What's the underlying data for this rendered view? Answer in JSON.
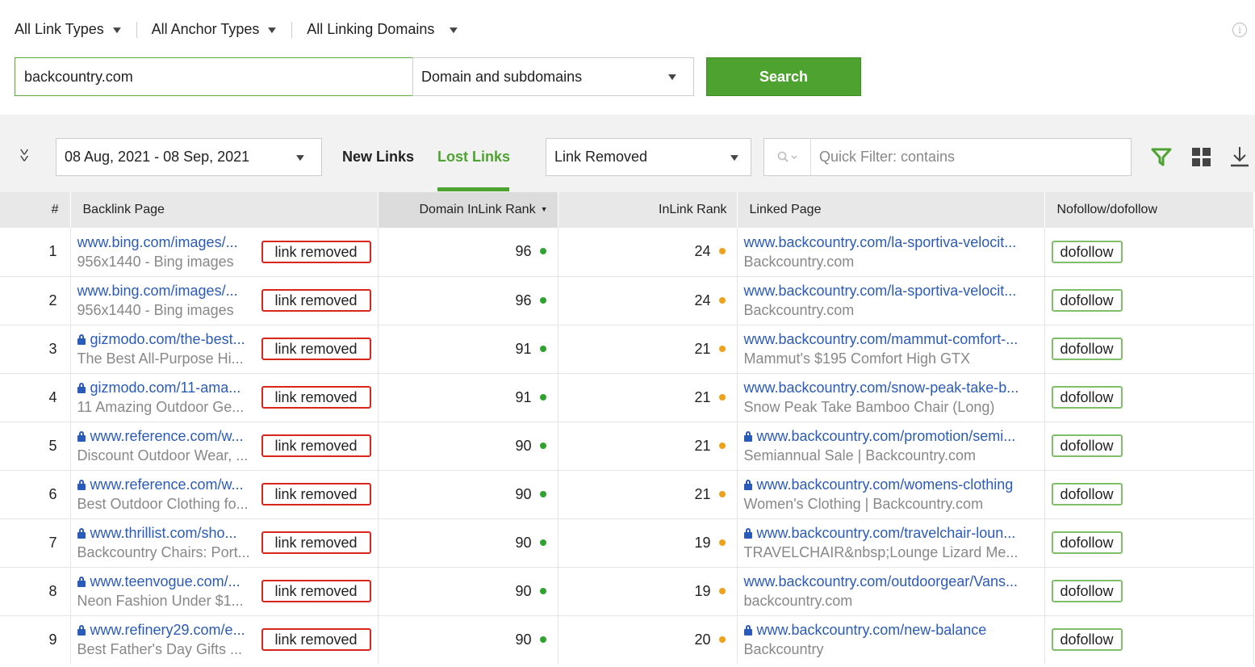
{
  "filters": {
    "link_types": "All Link Types",
    "anchor_types": "All Anchor Types",
    "linking_domains": "All Linking Domains",
    "info_icon": "info-icon",
    "chevron_icon": "chevron-down-icon"
  },
  "search": {
    "domain_value": "backcountry.com",
    "scope": "Domain and subdomains",
    "button_label": "Search"
  },
  "toolbar": {
    "date_range": "08 Aug, 2021 - 08 Sep, 2021",
    "tab_new": "New Links",
    "tab_lost": "Lost Links",
    "active_tab": "Lost Links",
    "reason": "Link Removed",
    "quick_filter_placeholder": "Quick Filter: contains",
    "accent_color": "#4ea330"
  },
  "table": {
    "headers": {
      "index": "#",
      "backlink_page": "Backlink Page",
      "domain_inlink_rank": "Domain InLink Rank",
      "inlink_rank": "InLink Rank",
      "linked_page": "Linked Page",
      "follow": "Nofollow/dofollow"
    },
    "rows": [
      {
        "n": "1",
        "bp_url": "www.bing.com/images/...",
        "bp_secure": false,
        "bp_title": "956x1440 - Bing images",
        "status": "link removed",
        "domain_rank": "96",
        "inlink_rank": "24",
        "lp_url": "www.backcountry.com/la-sportiva-velocit...",
        "lp_secure": false,
        "lp_title": "Backcountry.com",
        "follow": "dofollow"
      },
      {
        "n": "2",
        "bp_url": "www.bing.com/images/...",
        "bp_secure": false,
        "bp_title": "956x1440 - Bing images",
        "status": "link removed",
        "domain_rank": "96",
        "inlink_rank": "24",
        "lp_url": "www.backcountry.com/la-sportiva-velocit...",
        "lp_secure": false,
        "lp_title": "Backcountry.com",
        "follow": "dofollow"
      },
      {
        "n": "3",
        "bp_url": "gizmodo.com/the-best...",
        "bp_secure": true,
        "bp_title": "The Best All-Purpose Hi...",
        "status": "link removed",
        "domain_rank": "91",
        "inlink_rank": "21",
        "lp_url": "www.backcountry.com/mammut-comfort-...",
        "lp_secure": false,
        "lp_title": "Mammut's $195 Comfort High GTX",
        "follow": "dofollow"
      },
      {
        "n": "4",
        "bp_url": "gizmodo.com/11-ama...",
        "bp_secure": true,
        "bp_title": "11 Amazing Outdoor Ge...",
        "status": "link removed",
        "domain_rank": "91",
        "inlink_rank": "21",
        "lp_url": "www.backcountry.com/snow-peak-take-b...",
        "lp_secure": false,
        "lp_title": "Snow Peak Take Bamboo Chair (Long)",
        "follow": "dofollow"
      },
      {
        "n": "5",
        "bp_url": "www.reference.com/w...",
        "bp_secure": true,
        "bp_title": "Discount Outdoor Wear, ...",
        "status": "link removed",
        "domain_rank": "90",
        "inlink_rank": "21",
        "lp_url": "www.backcountry.com/promotion/semi...",
        "lp_secure": true,
        "lp_title": "Semiannual Sale | Backcountry.com",
        "follow": "dofollow"
      },
      {
        "n": "6",
        "bp_url": "www.reference.com/w...",
        "bp_secure": true,
        "bp_title": "Best Outdoor Clothing fo...",
        "status": "link removed",
        "domain_rank": "90",
        "inlink_rank": "21",
        "lp_url": "www.backcountry.com/womens-clothing",
        "lp_secure": true,
        "lp_title": "Women's Clothing | Backcountry.com",
        "follow": "dofollow"
      },
      {
        "n": "7",
        "bp_url": "www.thrillist.com/sho...",
        "bp_secure": true,
        "bp_title": "Backcountry Chairs: Port...",
        "status": "link removed",
        "domain_rank": "90",
        "inlink_rank": "19",
        "lp_url": "www.backcountry.com/travelchair-loun...",
        "lp_secure": true,
        "lp_title": "TRAVELCHAIR&nbsp;Lounge Lizard Me...",
        "follow": "dofollow"
      },
      {
        "n": "8",
        "bp_url": "www.teenvogue.com/...",
        "bp_secure": true,
        "bp_title": "Neon Fashion Under $1...",
        "status": "link removed",
        "domain_rank": "90",
        "inlink_rank": "19",
        "lp_url": "www.backcountry.com/outdoorgear/Vans...",
        "lp_secure": false,
        "lp_title": "backcountry.com",
        "follow": "dofollow"
      },
      {
        "n": "9",
        "bp_url": "www.refinery29.com/e...",
        "bp_secure": true,
        "bp_title": "Best Father's Day Gifts ...",
        "status": "link removed",
        "domain_rank": "90",
        "inlink_rank": "20",
        "lp_url": "www.backcountry.com/new-balance",
        "lp_secure": true,
        "lp_title": "Backcountry",
        "follow": "dofollow"
      }
    ]
  },
  "colors": {
    "domain_rank_dot": "#2ea42e",
    "inlink_rank_dot": "#f0a11b",
    "removed_border": "#d9261c",
    "follow_border": "#7fbf6a",
    "link": "#2b5bb8"
  }
}
